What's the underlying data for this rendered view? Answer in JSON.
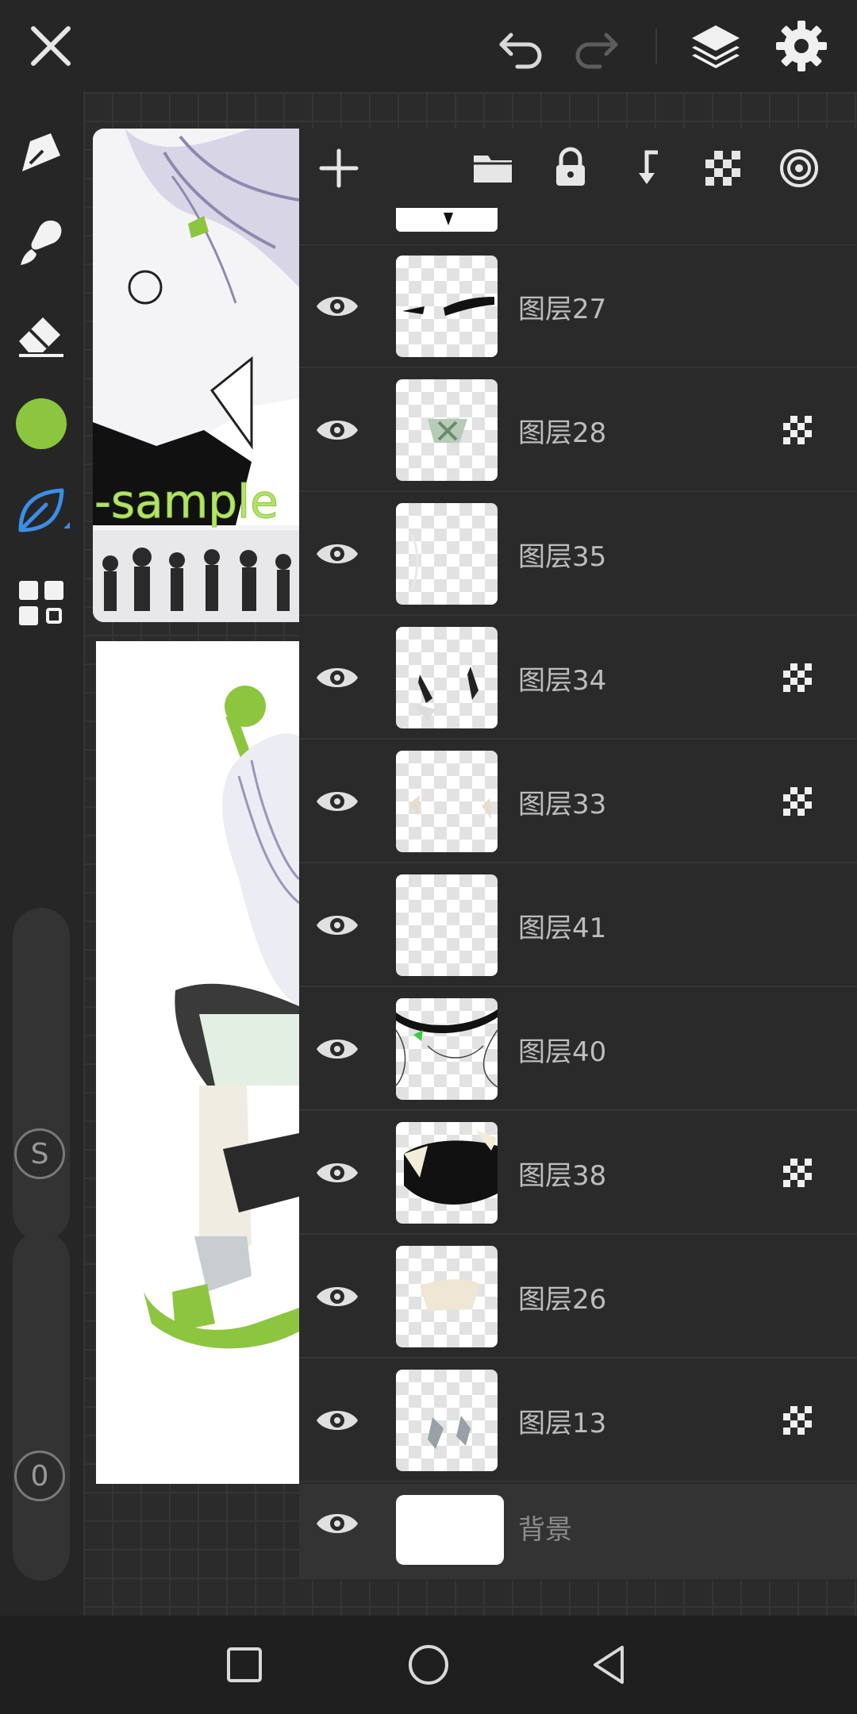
{
  "colors": {
    "background": "#262626",
    "current_color": "#8cc63f",
    "accent_blue": "#3a8ee6"
  },
  "top_bar": {
    "icons": [
      "close-icon",
      "undo-icon",
      "redo-icon",
      "layers-icon",
      "settings-icon"
    ]
  },
  "left_toolbar": {
    "tools": [
      "pen-tool-icon",
      "brush-tool-icon",
      "eraser-tool-icon",
      "color-swatch",
      "leaf-brush-icon",
      "grid-menu-icon"
    ],
    "size_slider_label": "S",
    "opacity_slider_label": "0"
  },
  "canvas": {
    "watermark_text": "-sample"
  },
  "layers_panel": {
    "toolbar_icons": [
      "add-layer-icon",
      "folder-icon",
      "lock-icon",
      "merge-down-icon",
      "alpha-lock-icon",
      "layer-effects-icon"
    ],
    "layers": [
      {
        "name": "图层27",
        "clipping": false
      },
      {
        "name": "图层28",
        "clipping": true
      },
      {
        "name": "图层35",
        "clipping": false
      },
      {
        "name": "图层34",
        "clipping": true
      },
      {
        "name": "图层33",
        "clipping": true
      },
      {
        "name": "图层41",
        "clipping": false
      },
      {
        "name": "图层40",
        "clipping": false
      },
      {
        "name": "图层38",
        "clipping": true
      },
      {
        "name": "图层26",
        "clipping": false
      },
      {
        "name": "图层13",
        "clipping": true
      }
    ],
    "background_layer": {
      "name": "背景"
    }
  },
  "nav_bar": {
    "icons": [
      "recent-apps-icon",
      "home-icon",
      "back-icon"
    ]
  }
}
